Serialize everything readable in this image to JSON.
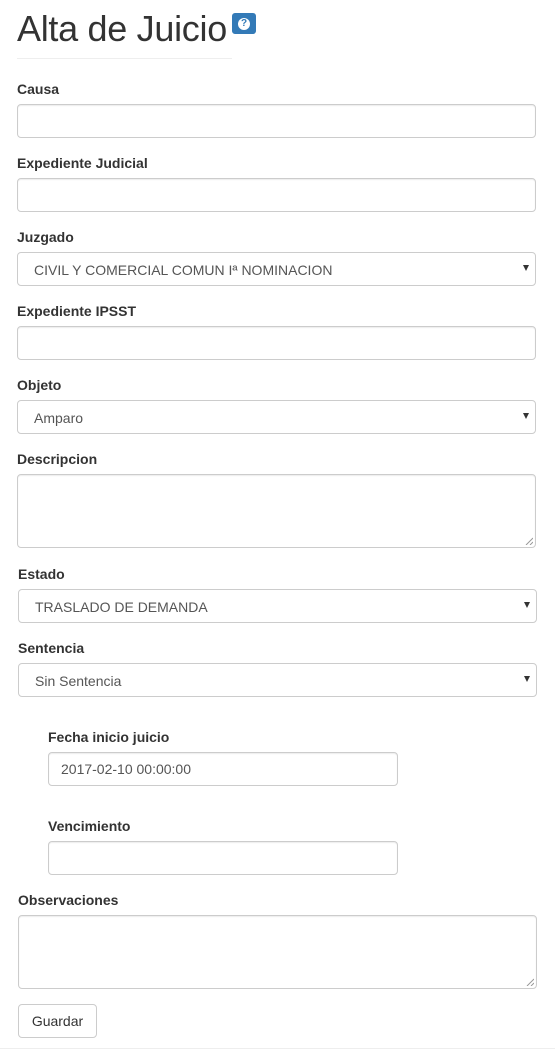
{
  "page": {
    "title": "Alta de Juicio",
    "help_icon": "question-circle-icon",
    "accent": "#337ab7"
  },
  "form": {
    "causa": {
      "label": "Causa",
      "value": ""
    },
    "expediente_judicial": {
      "label": "Expediente Judicial",
      "value": ""
    },
    "juzgado": {
      "label": "Juzgado",
      "selected": "CIVIL Y COMERCIAL COMUN Iª NOMINACION"
    },
    "expediente_ipsst": {
      "label": "Expediente IPSST",
      "value": ""
    },
    "objeto": {
      "label": "Objeto",
      "selected": "Amparo"
    },
    "descripcion": {
      "label": "Descripcion",
      "value": ""
    },
    "estado": {
      "label": "Estado",
      "selected": "TRASLADO DE DEMANDA"
    },
    "sentencia": {
      "label": "Sentencia",
      "selected": "Sin Sentencia"
    },
    "fecha_inicio": {
      "label": "Fecha inicio juicio",
      "value": "2017-02-10 00:00:00"
    },
    "vencimiento": {
      "label": "Vencimiento",
      "value": ""
    },
    "observaciones": {
      "label": "Observaciones",
      "value": ""
    },
    "submit_label": "Guardar"
  }
}
